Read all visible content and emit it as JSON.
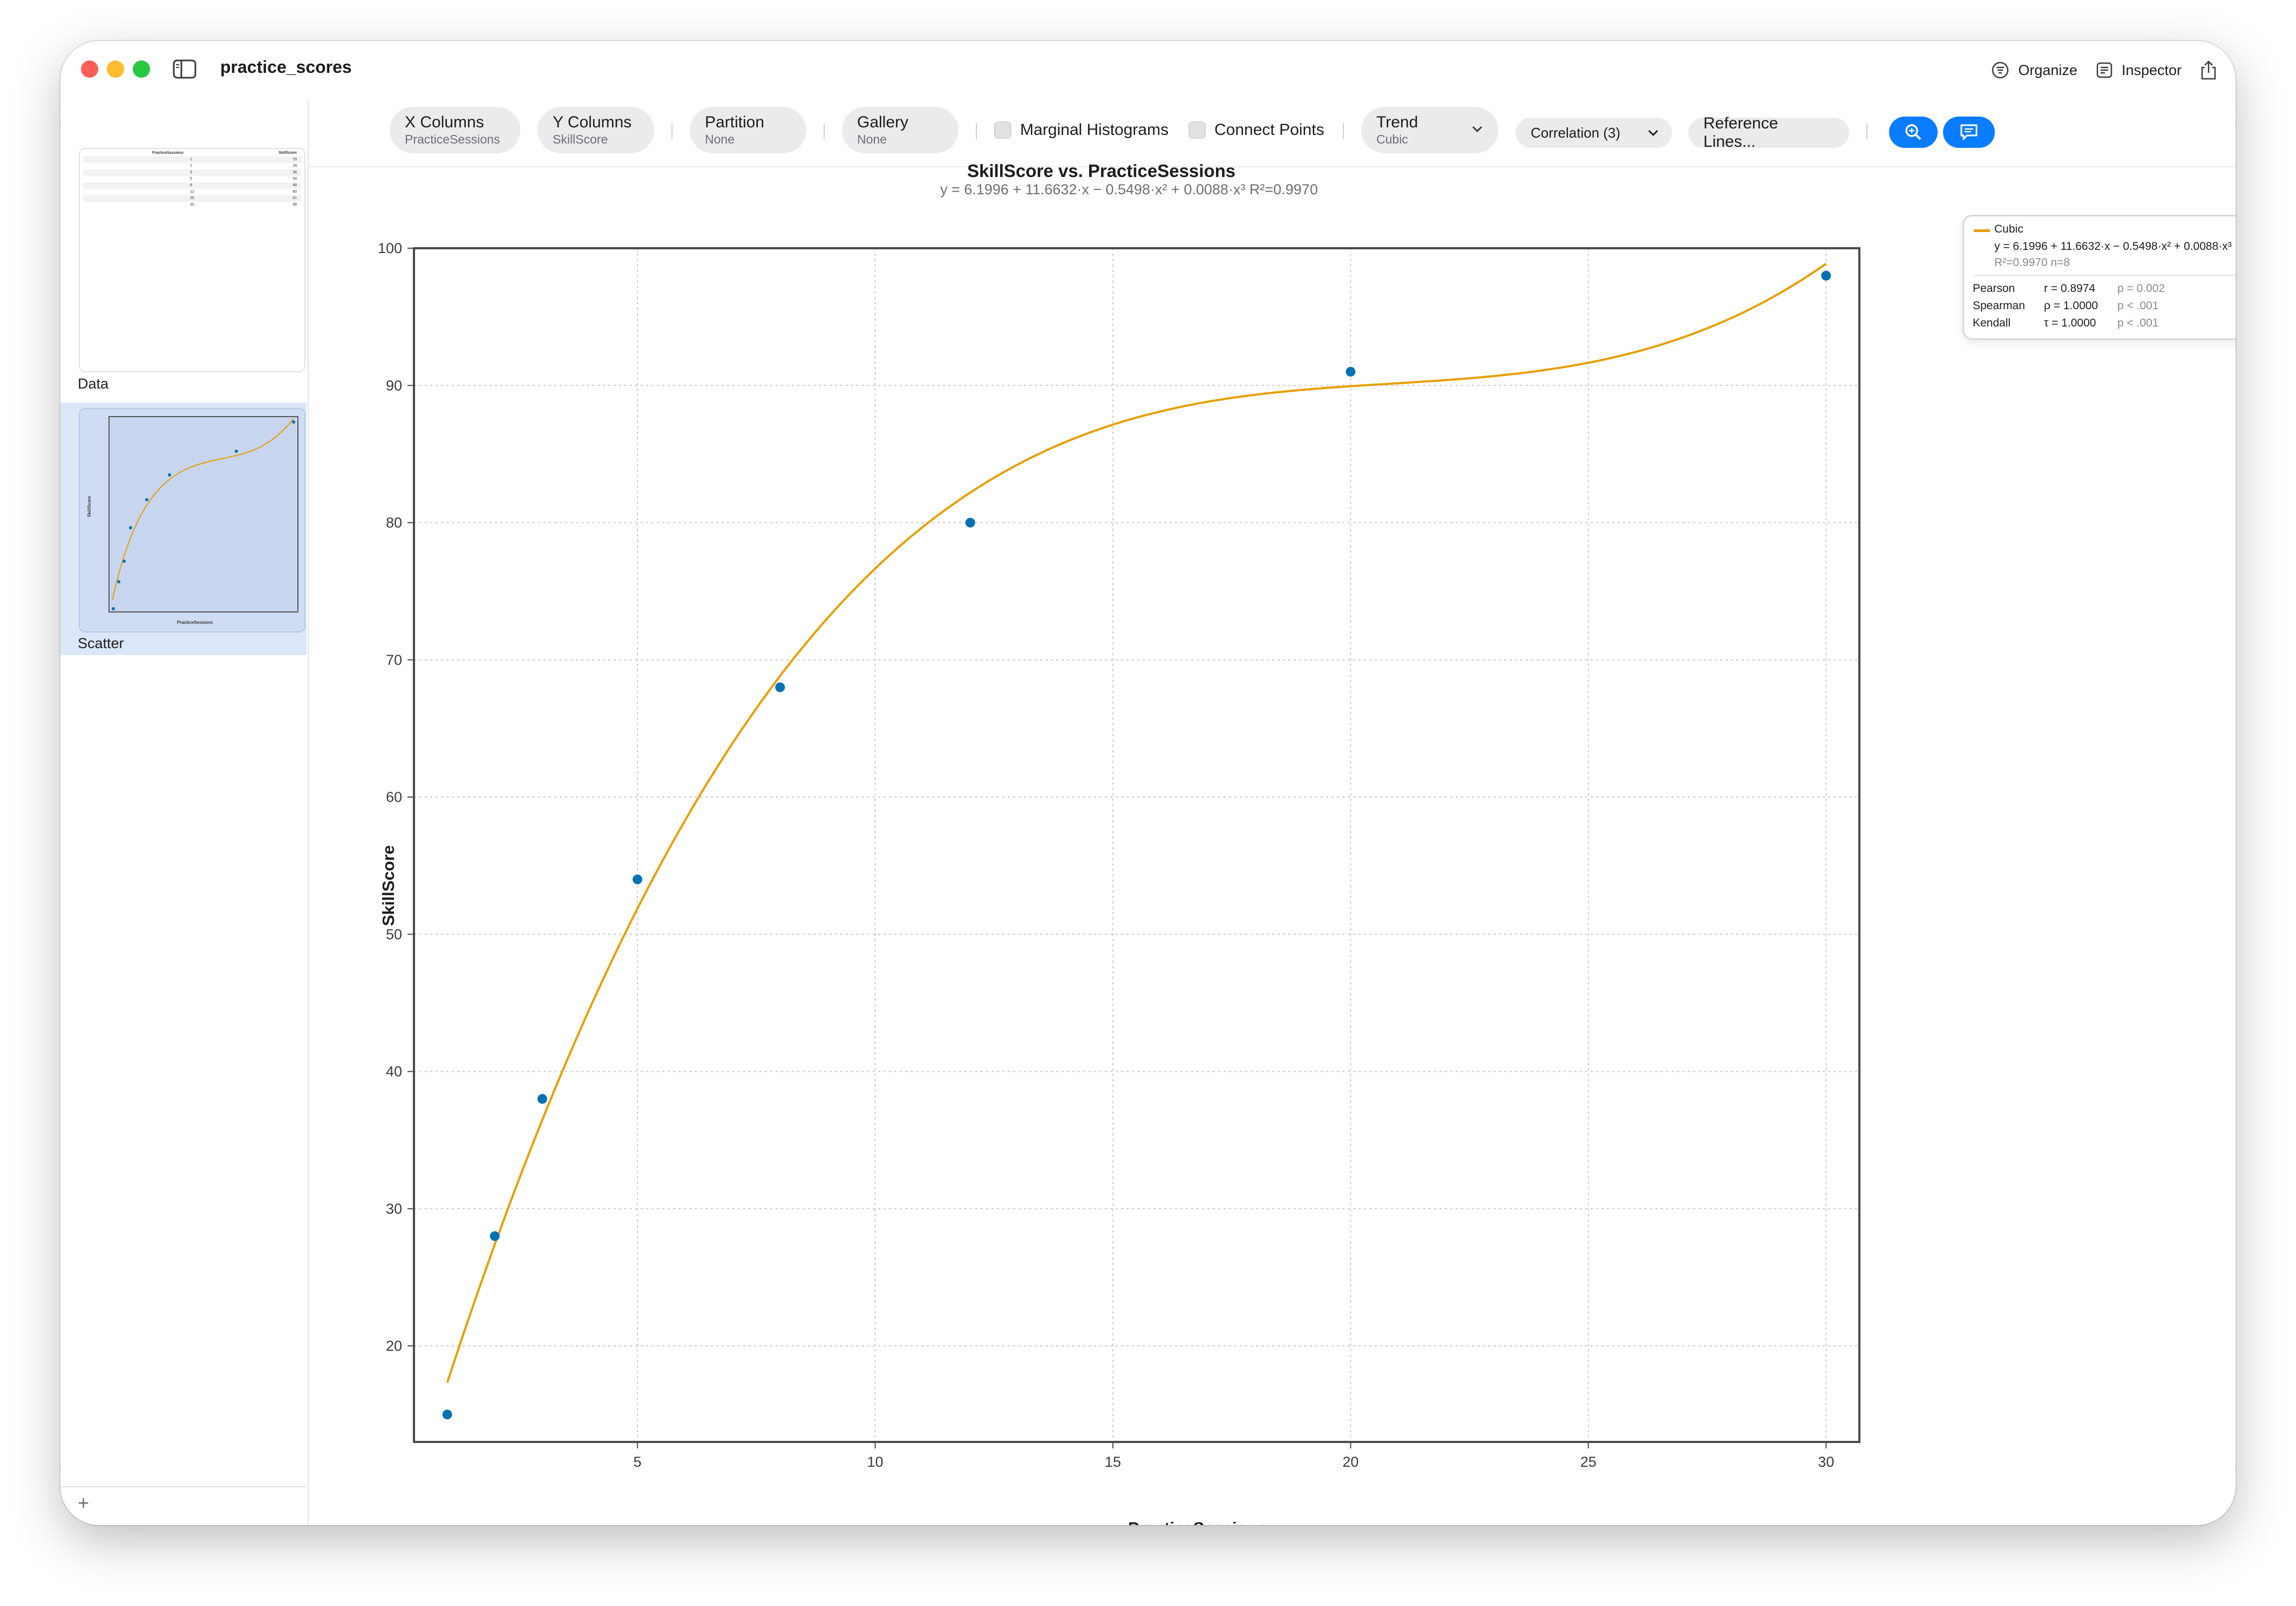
{
  "window": {
    "title": "practice_scores"
  },
  "titlebar": {
    "organize_label": "Organize",
    "inspector_label": "Inspector"
  },
  "sidebar": {
    "items": [
      {
        "label": "Data"
      },
      {
        "label": "Scatter",
        "selected": true
      }
    ],
    "data_thumb": {
      "headers": [
        "PracticeSessions",
        "SkillScore"
      ],
      "rows": [
        [
          "1",
          "15"
        ],
        [
          "2",
          "28"
        ],
        [
          "3",
          "38"
        ],
        [
          "5",
          "54"
        ],
        [
          "8",
          "68"
        ],
        [
          "12",
          "80"
        ],
        [
          "20",
          "91"
        ],
        [
          "30",
          "98"
        ]
      ]
    },
    "add_label": "+"
  },
  "toolbar": {
    "x_columns": {
      "label": "X Columns",
      "value": "PracticeSessions"
    },
    "y_columns": {
      "label": "Y Columns",
      "value": "SkillScore"
    },
    "partition": {
      "label": "Partition",
      "value": "None"
    },
    "gallery": {
      "label": "Gallery",
      "value": "None"
    },
    "marginal_histograms": {
      "label": "Marginal Histograms",
      "checked": false
    },
    "connect_points": {
      "label": "Connect Points",
      "checked": false
    },
    "trend": {
      "label": "Trend",
      "value": "Cubic"
    },
    "correlation": {
      "label": "Correlation (3)"
    },
    "reference_lines": {
      "label": "Reference Lines..."
    }
  },
  "legend": {
    "title": "Cubic",
    "equation": "y = 6.1996 + 11.6632·x − 0.5498·x² + 0.0088·x³",
    "stats": "R²=0.9970  n=8",
    "correlations": [
      {
        "name": "Pearson",
        "value": "r = 0.8974",
        "p": "p = 0.002"
      },
      {
        "name": "Spearman",
        "value": "ρ = 1.0000",
        "p": "p < .001"
      },
      {
        "name": "Kendall",
        "value": "τ = 1.0000",
        "p": "p < .001"
      }
    ],
    "trend_color": "#e69f00"
  },
  "chart_data": {
    "type": "scatter",
    "title": "SkillScore vs. PracticeSessions",
    "subtitle": "y = 6.1996 + 11.6632·x − 0.5498·x² + 0.0088·x³   R²=0.9970",
    "xlabel": "PracticeSessions",
    "ylabel": "SkillScore",
    "x": [
      1,
      2,
      3,
      5,
      8,
      12,
      20,
      30
    ],
    "y": [
      15,
      28,
      38,
      54,
      68,
      80,
      91,
      98
    ],
    "xlim": [
      0.3,
      30.7
    ],
    "ylim": [
      13,
      100
    ],
    "xticks": [
      5,
      10,
      15,
      20,
      25,
      30
    ],
    "yticks": [
      20,
      30,
      40,
      50,
      60,
      70,
      80,
      90,
      100
    ],
    "grid": true,
    "point_color": "#0072b2",
    "trend": {
      "type": "cubic",
      "coefficients": [
        6.1996,
        11.6632,
        -0.5498,
        0.0088
      ],
      "color": "#e69f00",
      "x_range": [
        1,
        30
      ]
    }
  }
}
